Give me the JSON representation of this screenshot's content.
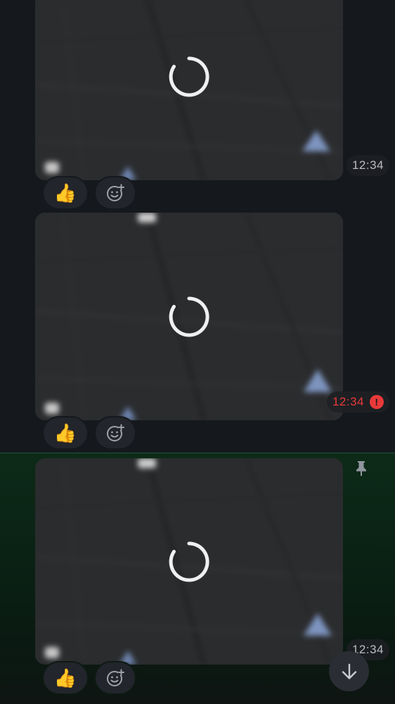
{
  "messages": [
    {
      "time": "12:34",
      "status": "sent",
      "reactions": [
        {
          "emoji": "👍"
        }
      ]
    },
    {
      "time": "12:34",
      "status": "error",
      "error_glyph": "!",
      "reactions": [
        {
          "emoji": "👍"
        }
      ]
    },
    {
      "time": "12:34",
      "status": "sent",
      "pinned": true,
      "reactions": [
        {
          "emoji": "👍"
        }
      ]
    }
  ],
  "icons": {
    "loading": "loading-spinner-icon",
    "add_reaction": "add-reaction-icon",
    "pin": "pin-icon",
    "scroll_down": "arrow-down-icon",
    "error": "error-icon"
  },
  "colors": {
    "background": "#15181d",
    "bubble": "#2a2b2d",
    "error": "#e9393b",
    "pinned_background": "#0a2214",
    "timestamp": "#b9bcc2"
  }
}
